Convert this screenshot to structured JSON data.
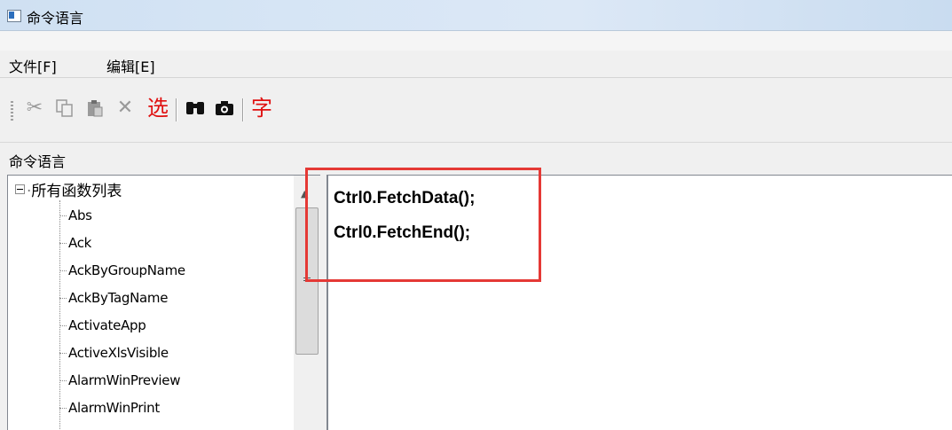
{
  "window": {
    "title": "命令语言"
  },
  "menu": {
    "file": "文件[F]",
    "edit": "编辑[E]"
  },
  "toolbar": {
    "select_label": "选",
    "char_label": "字"
  },
  "panel": {
    "title": "命令语言"
  },
  "tree": {
    "root": "所有函数列表",
    "items": [
      "Abs",
      "Ack",
      "AckByGroupName",
      "AckByTagName",
      "ActivateApp",
      "ActiveXlsVisible",
      "AlarmWinPreview",
      "AlarmWinPrint"
    ]
  },
  "editor": {
    "lines": [
      "Ctrl0.FetchData();",
      "Ctrl0.FetchEnd();"
    ]
  },
  "colors": {
    "highlight": "#e53935",
    "red_text": "#e01010"
  }
}
